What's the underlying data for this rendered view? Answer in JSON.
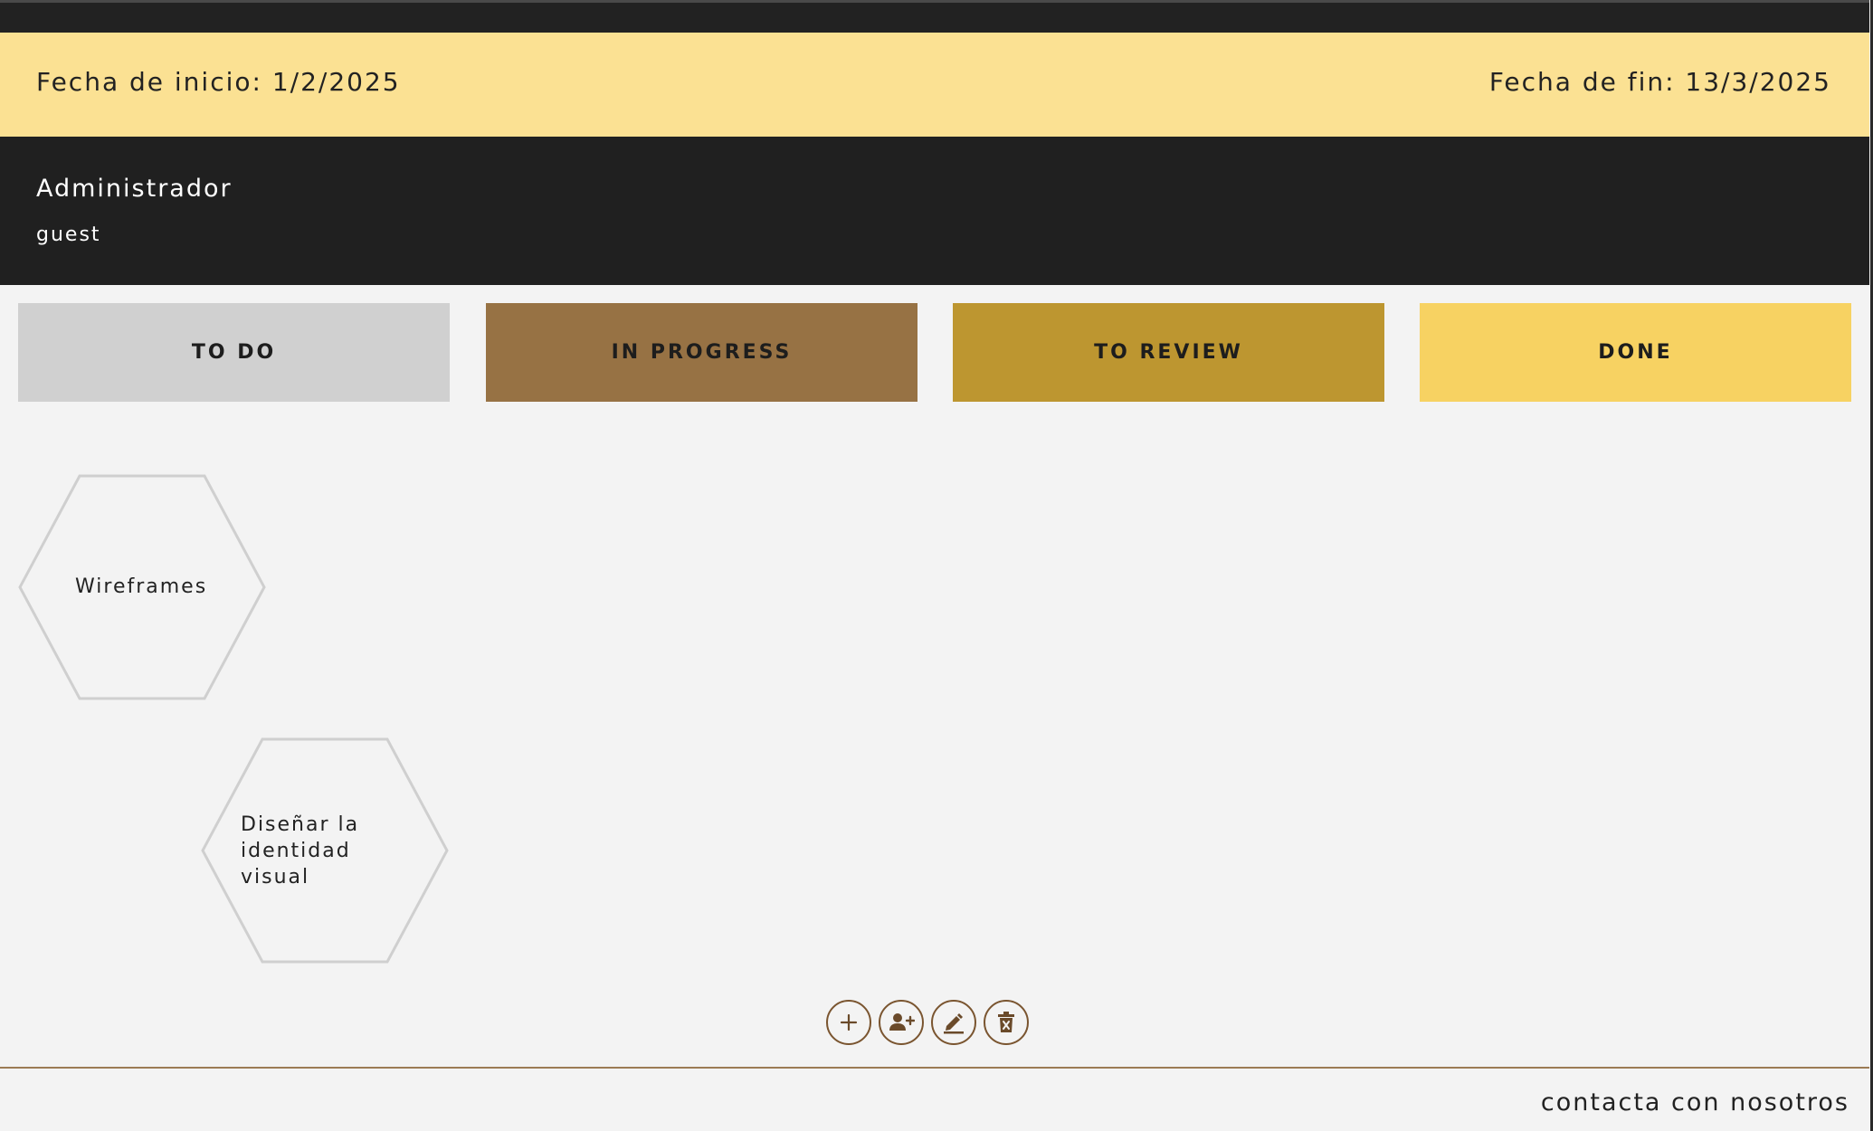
{
  "header": {
    "start_date_text": "Fecha de inicio: 1/2/2025",
    "end_date_text": "Fecha de fin: 13/3/2025"
  },
  "user": {
    "role": "Administrador",
    "name": "guest"
  },
  "columns": [
    {
      "label": "TO DO",
      "color": "#d0d0d0"
    },
    {
      "label": "IN PROGRESS",
      "color": "#977244"
    },
    {
      "label": "TO REVIEW",
      "color": "#bd9630"
    },
    {
      "label": "DONE",
      "color": "#f7d262"
    }
  ],
  "tasks": [
    {
      "title": "Wireframes",
      "column": "TO DO"
    },
    {
      "title": "Diseñar la identidad visual",
      "column": "TO DO"
    }
  ],
  "toolbar": {
    "buttons": [
      {
        "icon": "plus-icon"
      },
      {
        "icon": "add-user-icon"
      },
      {
        "icon": "edit-pencil-icon"
      },
      {
        "icon": "delete-trash-icon"
      }
    ]
  },
  "footer": {
    "contact_link": "contacta con nosotros"
  },
  "colors": {
    "date_bar": "#fbe193",
    "user_bar": "#202020",
    "accent": "#7a5530",
    "background": "#f3f3f3"
  }
}
